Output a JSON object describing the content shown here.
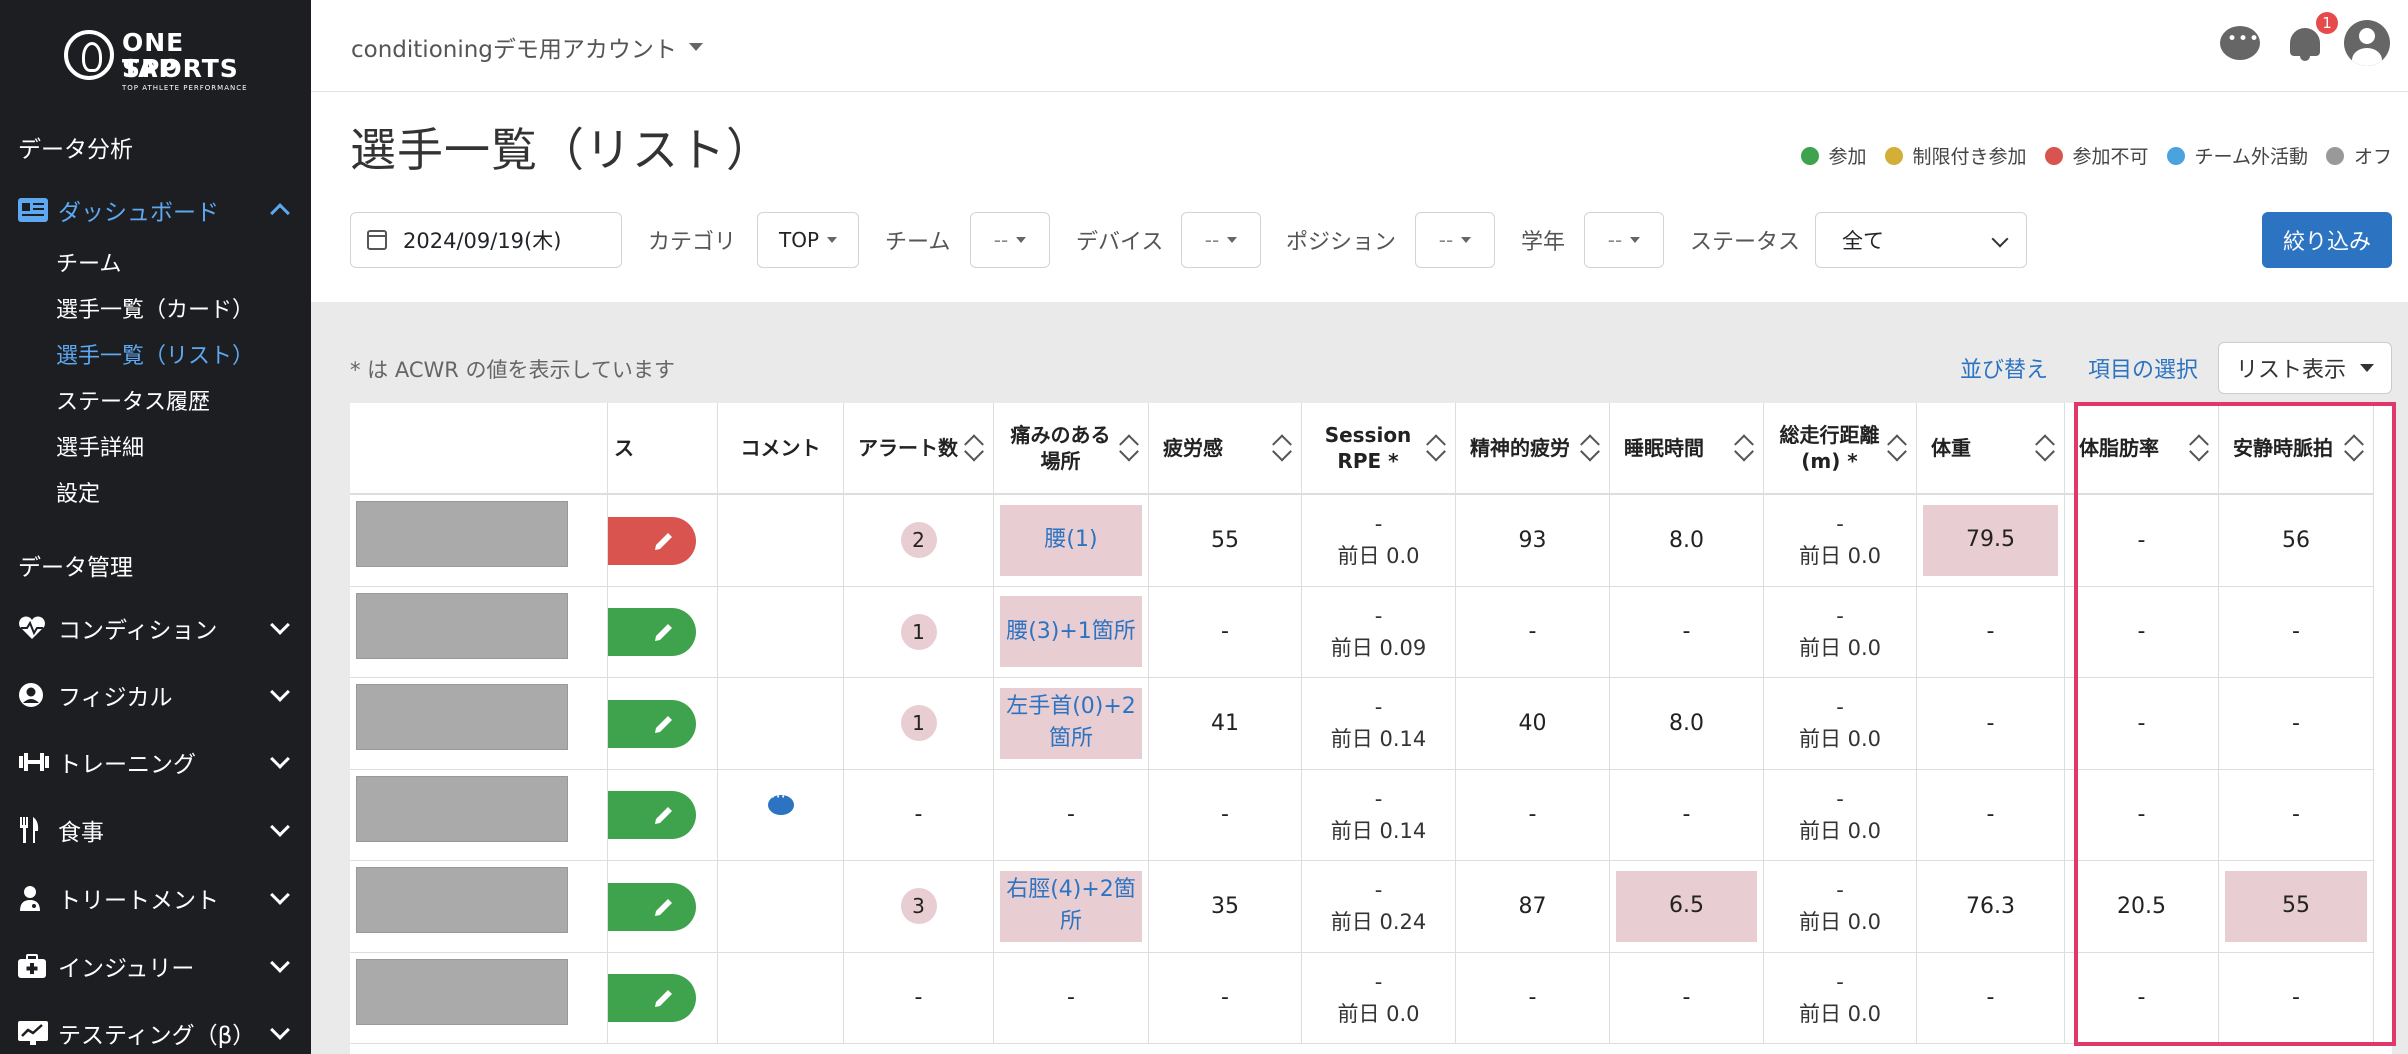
{
  "brand": {
    "line1": "ONE TAP",
    "line2": "SPORTS",
    "tagline": "TOP ATHLETE PERFORMANCE"
  },
  "sidebar": {
    "section_analysis": "データ分析",
    "dashboard": "ダッシュボード",
    "dashboard_items": [
      "チーム",
      "選手一覧（カード）",
      "選手一覧（リスト）",
      "ステータス履歴",
      "選手詳細",
      "設定"
    ],
    "section_management": "データ管理",
    "groups": [
      "コンディション",
      "フィジカル",
      "トレーニング",
      "食事",
      "トリートメント",
      "インジュリー",
      "テスティング（β）"
    ]
  },
  "topbar": {
    "account": "conditioningデモ用アカウント",
    "notification_count": "1"
  },
  "page": {
    "title": "選手一覧（リスト）"
  },
  "legend": [
    {
      "label": "参加",
      "color": "#3fa34d"
    },
    {
      "label": "制限付き参加",
      "color": "#d4af37"
    },
    {
      "label": "参加不可",
      "color": "#d9534f"
    },
    {
      "label": "チーム外活動",
      "color": "#4aa3df"
    },
    {
      "label": "オフ",
      "color": "#999999"
    }
  ],
  "filters": {
    "date": "2024/09/19(木)",
    "category_label": "カテゴリ",
    "category_value": "TOP",
    "team_label": "チーム",
    "team_value": "--",
    "device_label": "デバイス",
    "device_value": "--",
    "position_label": "ポジション",
    "position_value": "--",
    "grade_label": "学年",
    "grade_value": "--",
    "status_label": "ステータス",
    "status_value": "全て",
    "apply_button": "絞り込み"
  },
  "toolbar": {
    "note": "* は ACWR の値を表示しています",
    "sort_link": "並び替え",
    "columns_link": "項目の選択",
    "view_button": "リスト表示"
  },
  "table": {
    "partial_header": "ス",
    "headers": {
      "comment": "コメント",
      "alerts": "アラート数",
      "pain": "痛みのある場所",
      "fatigue": "疲労感",
      "rpe": "Session RPE *",
      "mental": "精神的疲労",
      "sleep": "睡眠時間",
      "distance": "総走行距離(m) *",
      "weight": "体重",
      "bodyfat": "体脂肪率",
      "hr": "安静時脈拍"
    },
    "rows": [
      {
        "status_color": "#d9534f",
        "comment": false,
        "alerts": "2",
        "pain": "腰(1)",
        "fatigue": "55",
        "rpe1": "-",
        "rpe2": "前日 0.0",
        "mental": "93",
        "sleep": "8.0",
        "sleep_hl": false,
        "dist1": "-",
        "dist2": "前日 0.0",
        "weight": "79.5",
        "weight_hl": true,
        "bodyfat": "-",
        "hr": "56",
        "hr_hl": false
      },
      {
        "status_color": "#3fa34d",
        "comment": false,
        "alerts": "1",
        "pain": "腰(3)+1箇所",
        "fatigue": "-",
        "rpe1": "-",
        "rpe2": "前日 0.09",
        "mental": "-",
        "sleep": "-",
        "sleep_hl": false,
        "dist1": "-",
        "dist2": "前日 0.0",
        "weight": "-",
        "weight_hl": false,
        "bodyfat": "-",
        "hr": "-",
        "hr_hl": false
      },
      {
        "status_color": "#3fa34d",
        "comment": false,
        "alerts": "1",
        "pain": "左手首(0)+2箇所",
        "fatigue": "41",
        "rpe1": "-",
        "rpe2": "前日 0.14",
        "mental": "40",
        "sleep": "8.0",
        "sleep_hl": false,
        "dist1": "-",
        "dist2": "前日 0.0",
        "weight": "-",
        "weight_hl": false,
        "bodyfat": "-",
        "hr": "-",
        "hr_hl": false
      },
      {
        "status_color": "#3fa34d",
        "comment": true,
        "alerts": "-",
        "pain": "-",
        "fatigue": "-",
        "rpe1": "-",
        "rpe2": "前日 0.14",
        "mental": "-",
        "sleep": "-",
        "sleep_hl": false,
        "dist1": "-",
        "dist2": "前日 0.0",
        "weight": "-",
        "weight_hl": false,
        "bodyfat": "-",
        "hr": "-",
        "hr_hl": false
      },
      {
        "status_color": "#3fa34d",
        "comment": false,
        "alerts": "3",
        "pain": "右脛(4)+2箇所",
        "fatigue": "35",
        "rpe1": "-",
        "rpe2": "前日 0.24",
        "mental": "87",
        "sleep": "6.5",
        "sleep_hl": true,
        "dist1": "-",
        "dist2": "前日 0.0",
        "weight": "76.3",
        "weight_hl": false,
        "bodyfat": "20.5",
        "hr": "55",
        "hr_hl": true
      },
      {
        "status_color": "#3fa34d",
        "comment": false,
        "alerts": "-",
        "pain": "-",
        "fatigue": "-",
        "rpe1": "-",
        "rpe2": "前日 0.0",
        "mental": "-",
        "sleep": "-",
        "sleep_hl": false,
        "dist1": "-",
        "dist2": "前日 0.0",
        "weight": "-",
        "weight_hl": false,
        "bodyfat": "-",
        "hr": "-",
        "hr_hl": false
      }
    ]
  }
}
